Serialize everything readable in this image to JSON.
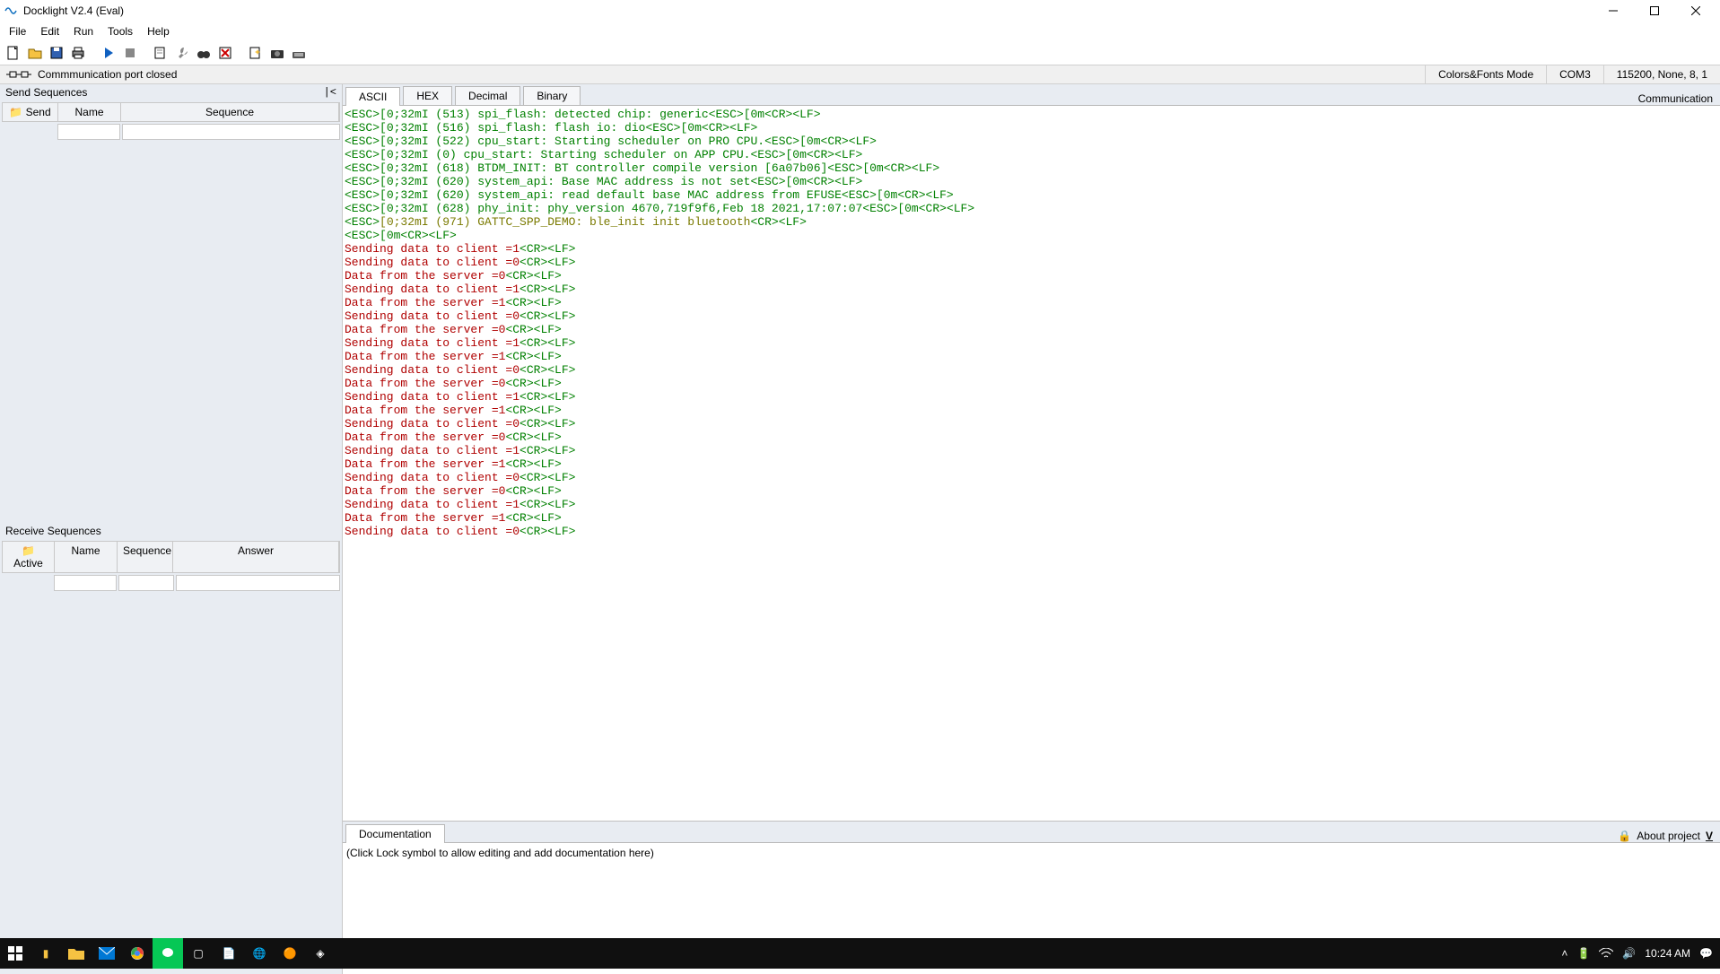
{
  "titlebar": {
    "title": "Docklight V2.4 (Eval)"
  },
  "menu": {
    "file": "File",
    "edit": "Edit",
    "run": "Run",
    "tools": "Tools",
    "help": "Help"
  },
  "commstrip": {
    "port_status": "Commmunication port closed",
    "mode": "Colors&Fonts Mode",
    "port": "COM3",
    "settings": "115200, None, 8, 1"
  },
  "leftpanel": {
    "send_title": "Send Sequences",
    "send_cols": {
      "send": "Send",
      "name": "Name",
      "sequence": "Sequence"
    },
    "recv_title": "Receive Sequences",
    "recv_cols": {
      "active": "Active",
      "name": "Name",
      "sequence": "Sequence",
      "answer": "Answer"
    }
  },
  "tabs": {
    "ascii": "ASCII",
    "hex": "HEX",
    "decimal": "Decimal",
    "binary": "Binary",
    "rlabel": "Communication"
  },
  "terminal": {
    "log_lines": [
      {
        "body": "[0;32mI (513) spi_flash: detected chip: generic",
        "trail": "[0m"
      },
      {
        "body": "[0;32mI (516) spi_flash: flash io: dio",
        "trail": "[0m"
      },
      {
        "body": "[0;32mI (522) cpu_start: Starting scheduler on PRO CPU.",
        "trail": "[0m"
      },
      {
        "body": "[0;32mI (0) cpu_start: Starting scheduler on APP CPU.",
        "trail": "[0m"
      },
      {
        "body": "[0;32mI (618) BTDM_INIT: BT controller compile version [6a07b06]",
        "trail": "[0m"
      },
      {
        "body": "[0;32mI (620) system_api: Base MAC address is not set",
        "trail": "[0m"
      },
      {
        "body": "[0;32mI (620) system_api: read default base MAC address from EFUSE",
        "trail": "[0m"
      },
      {
        "body": "[0;32mI (628) phy_init: phy_version 4670,719f9f6,Feb 18 2021,17:07:07",
        "trail": "[0m"
      },
      {
        "body_olive": "[0;32mI (971) GATTC_SPP_DEMO: ble_init init bluetooth"
      }
    ],
    "trail_only": "[0m",
    "data_lines": [
      "Sending data to client =1",
      "Sending data to client =0",
      "Data from the server =0",
      "Sending data to client =1",
      "Data from the server =1",
      "Sending data to client =0",
      "Data from the server =0",
      "Sending data to client =1",
      "Data from the server =1",
      "Sending data to client =0",
      "Data from the server =0",
      "Sending data to client =1",
      "Data from the server =1",
      "Sending data to client =0",
      "Data from the server =0",
      "Sending data to client =1",
      "Data from the server =1",
      "Sending data to client =0",
      "Data from the server =0",
      "Sending data to client =1",
      "Data from the server =1",
      "Sending data to client =0"
    ]
  },
  "docpanel": {
    "tab": "Documentation",
    "about": "About project",
    "v": "V",
    "placeholder": "(Click Lock symbol to allow editing and add documentation here)"
  },
  "taskbar": {
    "time": "10:24 AM"
  }
}
